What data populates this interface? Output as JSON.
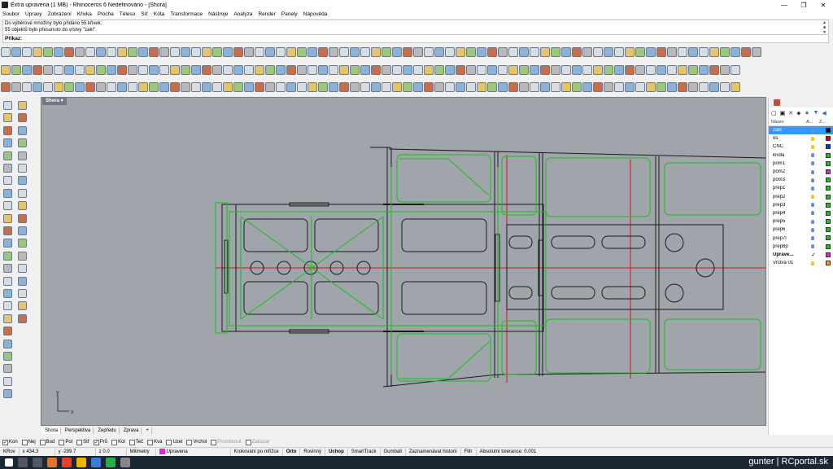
{
  "window": {
    "title": "Extra upravena (1 MB) - Rhinoceros 6 Nedefinováno - [Shora]",
    "minimize": "—",
    "maximize": "❐",
    "close": "✕"
  },
  "menu": [
    "Soubor",
    "Úpravy",
    "Zobrazení",
    "Křivka",
    "Plocha",
    "Těleso",
    "Síť",
    "Kóta",
    "Transformace",
    "Nástroje",
    "Analýza",
    "Render",
    "Panely",
    "Nápověda"
  ],
  "command_history": [
    "Do výběrové množiny bylo přidáno 55 křivek.",
    "55 objektů bylo přesunuto do vrstvy \"zakl\"."
  ],
  "command_prompt": "Příkaz:",
  "viewport": {
    "label": "Shora",
    "axis_y": "y",
    "axis_x": "x"
  },
  "view_tabs": [
    "Shora",
    "Perspektiva",
    "Zepředu",
    "Zprava",
    "+"
  ],
  "layers_panel": {
    "columns": {
      "name": "Název",
      "a": "A...",
      "z": "Z..."
    },
    "layers": [
      {
        "name": "zakl",
        "color": "#000000",
        "selected": true,
        "state": "bulb"
      },
      {
        "name": "os",
        "color": "#e00000",
        "state": "bulb-on"
      },
      {
        "name": "CNC",
        "color": "#1030d0",
        "state": "bulb-on"
      },
      {
        "name": "kridla",
        "color": "#20c020",
        "state": "bulb"
      },
      {
        "name": "pom1",
        "color": "#20c020",
        "state": "bulb"
      },
      {
        "name": "pom2",
        "color": "#e020e0",
        "state": "bulb"
      },
      {
        "name": "pom3",
        "color": "#20c020",
        "state": "bulb"
      },
      {
        "name": "prep1",
        "color": "#20c020",
        "state": "bulb"
      },
      {
        "name": "prep2",
        "color": "#20c020",
        "state": "bulb-on"
      },
      {
        "name": "prep3",
        "color": "#20c020",
        "state": "bulb"
      },
      {
        "name": "prep4",
        "color": "#20c020",
        "state": "bulb"
      },
      {
        "name": "prep5",
        "color": "#20c020",
        "state": "bulb"
      },
      {
        "name": "prep6",
        "color": "#20c020",
        "state": "bulb"
      },
      {
        "name": "prep7l",
        "color": "#20c020",
        "state": "bulb"
      },
      {
        "name": "prep8p",
        "color": "#20c020",
        "state": "bulb"
      },
      {
        "name": "Uprave...",
        "color": "#cc33cc",
        "state": "check",
        "bold": true
      },
      {
        "name": "Vrstva 01",
        "color": "#ff9900",
        "state": "bulb-on"
      }
    ]
  },
  "osnaps": [
    {
      "label": "Kon",
      "checked": true
    },
    {
      "label": "Nej",
      "checked": false
    },
    {
      "label": "Bod",
      "checked": false
    },
    {
      "label": "Pol",
      "checked": false
    },
    {
      "label": "Stř",
      "checked": false
    },
    {
      "label": "Prů",
      "checked": true
    },
    {
      "label": "Kol",
      "checked": false
    },
    {
      "label": "Teč",
      "checked": false
    },
    {
      "label": "Kva",
      "checked": false
    },
    {
      "label": "Uzel",
      "checked": false
    },
    {
      "label": "Vrchol",
      "checked": false
    },
    {
      "label": "Promítnout",
      "checked": false,
      "disabled": true
    },
    {
      "label": "Zakázat",
      "checked": false,
      "disabled": true
    }
  ],
  "status": {
    "cplane": "KRov",
    "x": "x 434.3",
    "y": "y -299.7",
    "z": "z 0.0",
    "units": "Milimetry",
    "layer": "Upravena",
    "toggles": [
      {
        "label": "Krokování po mřížce",
        "bold": false
      },
      {
        "label": "Orto",
        "bold": true
      },
      {
        "label": "Rovinný",
        "bold": false
      },
      {
        "label": "Uchop",
        "bold": true
      },
      {
        "label": "SmartTrack",
        "bold": false
      },
      {
        "label": "Gumball",
        "bold": false
      },
      {
        "label": "Zaznamenávat historii",
        "bold": false
      },
      {
        "label": "Filtr",
        "bold": false
      }
    ],
    "tolerance": "Absolutní tolerance: 0.001"
  },
  "watermark": "gunter | RCportal.sk"
}
